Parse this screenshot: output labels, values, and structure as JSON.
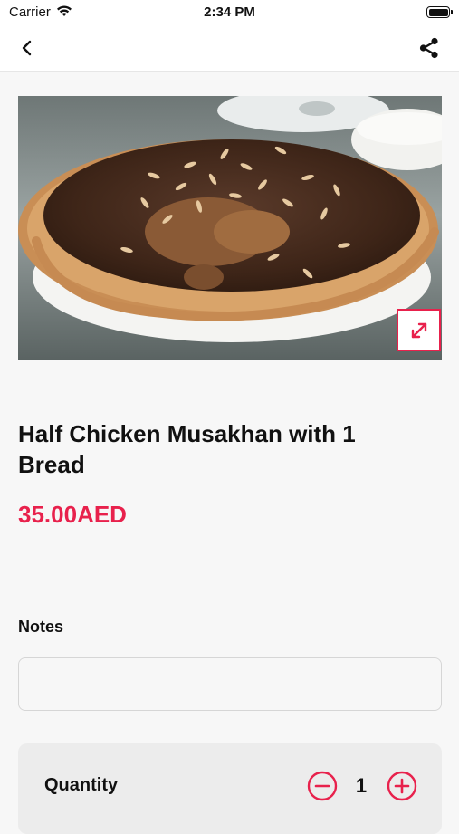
{
  "status_bar": {
    "carrier": "Carrier",
    "time": "2:34 PM",
    "wifi_icon": "wifi-icon",
    "battery_icon": "battery-icon"
  },
  "nav": {
    "back_icon": "chevron-left-icon",
    "share_icon": "share-icon"
  },
  "product": {
    "image_alt": "musakhan",
    "expand_icon": "expand-icon",
    "title": "Half Chicken Musakhan with 1 Bread",
    "price": "35.00AED"
  },
  "notes": {
    "label": "Notes",
    "value": "",
    "placeholder": ""
  },
  "quantity": {
    "label": "Quantity",
    "value": "1",
    "minus_icon": "minus-circle-icon",
    "plus_icon": "plus-circle-icon"
  },
  "colors": {
    "accent": "#e8214c",
    "background": "#f7f7f7",
    "card": "#ececec"
  }
}
